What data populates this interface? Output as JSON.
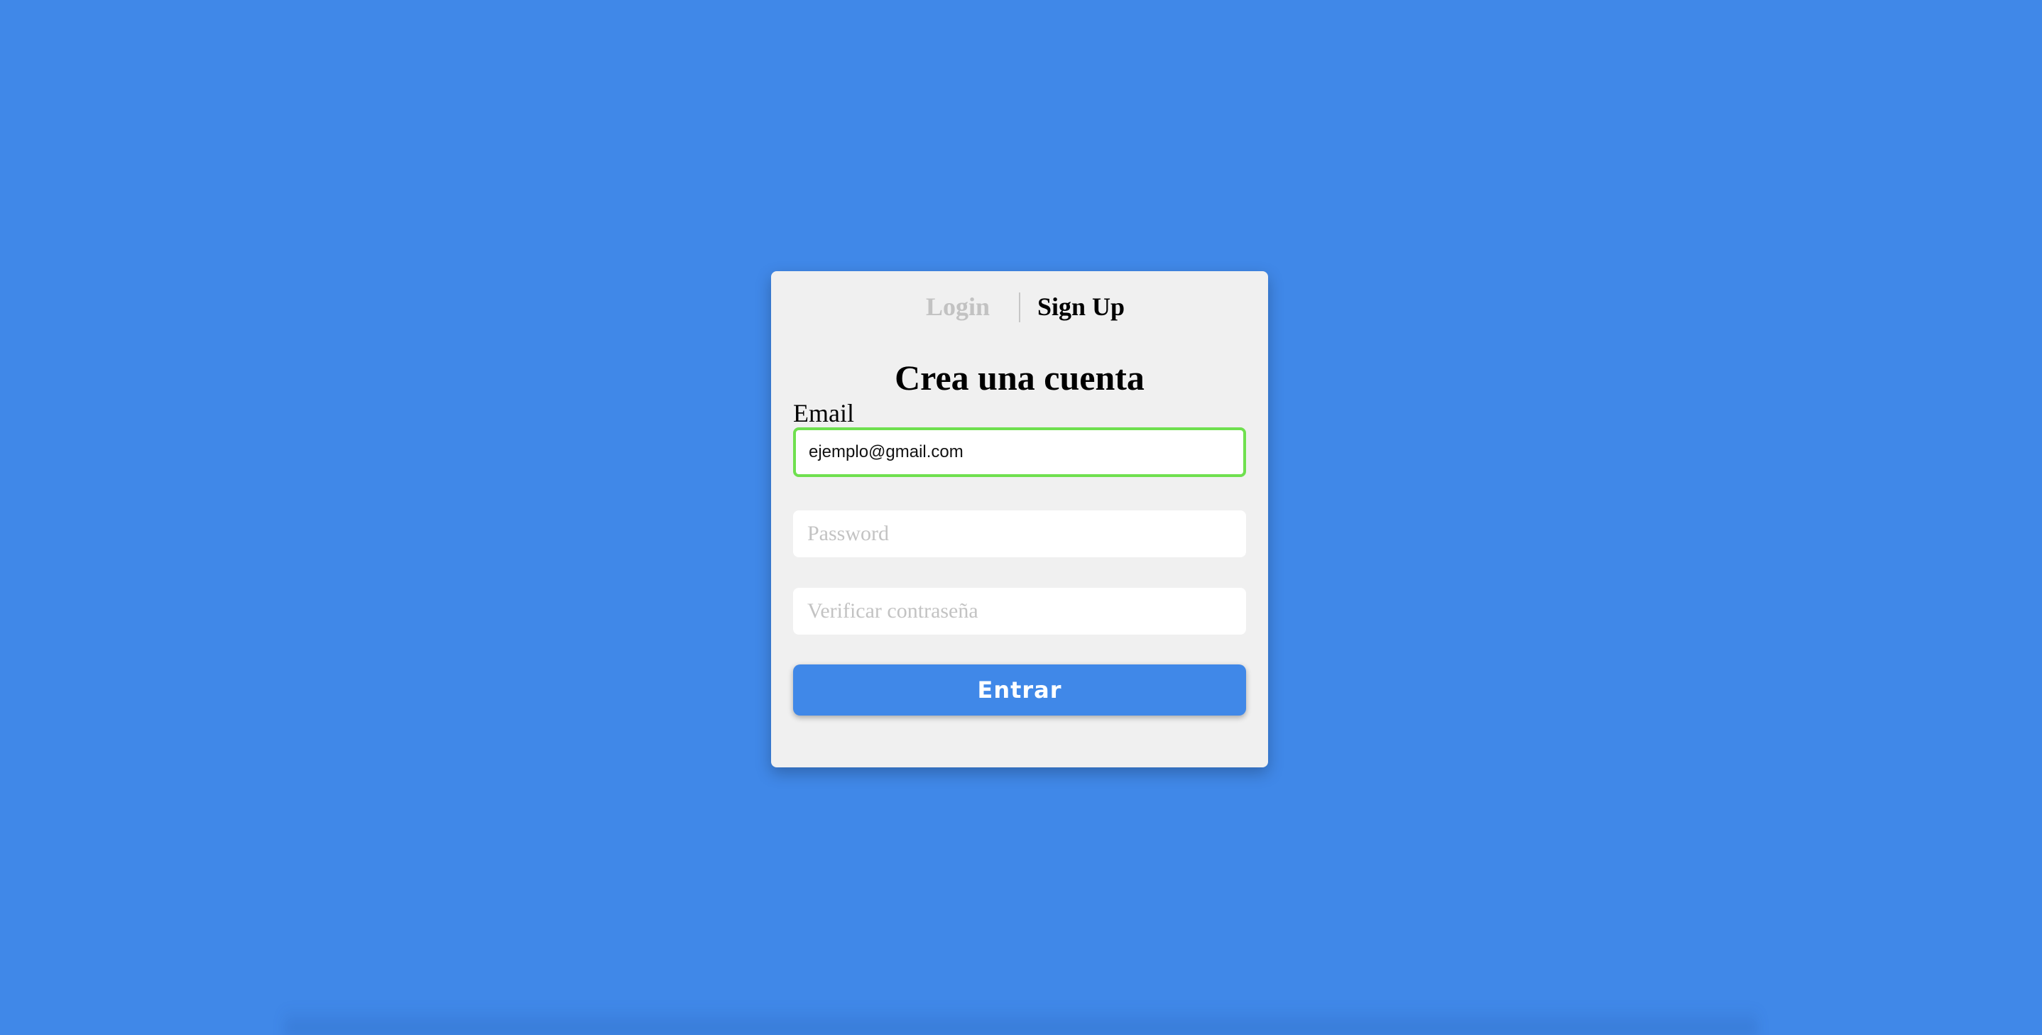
{
  "tabs": {
    "login_label": "Login",
    "signup_label": "Sign Up",
    "active": "signup"
  },
  "form": {
    "title": "Crea una cuenta",
    "email_label": "Email",
    "email_value": "ejemplo@gmail.com",
    "password_placeholder": "Password",
    "verify_placeholder": "Verificar contraseña",
    "submit_label": "Entrar"
  },
  "colors": {
    "background": "#4088e8",
    "card": "#f0f0f0",
    "button": "#4088e8",
    "focus_border": "#6fe04f",
    "inactive_tab": "#c2c2c2"
  }
}
